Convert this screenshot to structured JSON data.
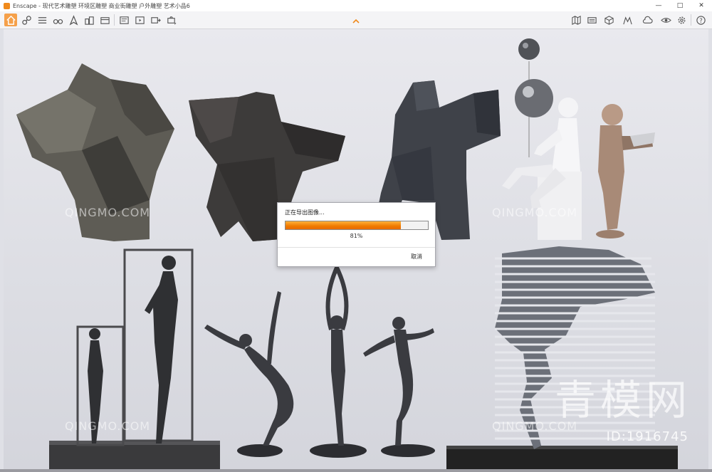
{
  "window": {
    "app_name": "Enscape",
    "title": "Enscape - 现代艺术雕塑 环境区雕塑 商业街雕塑 户外雕塑 艺术小品6",
    "controls": {
      "minimize": "—",
      "maximize": "□",
      "close": "✕"
    }
  },
  "toolbar": {
    "left_icons": [
      "home-icon",
      "link-icon",
      "settings-list-icon",
      "binoculars-icon",
      "navigate-icon",
      "buildings-icon",
      "assets-icon",
      "screenshot-icon",
      "video-icon",
      "export-icon",
      "capture-icon"
    ],
    "right_icons": [
      "map-icon",
      "panorama-icon",
      "cube-icon",
      "materials-icon",
      "views-icon",
      "cloud-icon",
      "visual-settings-icon",
      "help-icon"
    ],
    "accent": "#f5a04a"
  },
  "dialog": {
    "title": "正在导出图像...",
    "progress": 0.81,
    "percent_text": "81%",
    "cancel_label": "取消"
  },
  "watermarks": {
    "text": "QINGMO.COM",
    "logo": "青模网",
    "id_text": "ID:1916745"
  }
}
